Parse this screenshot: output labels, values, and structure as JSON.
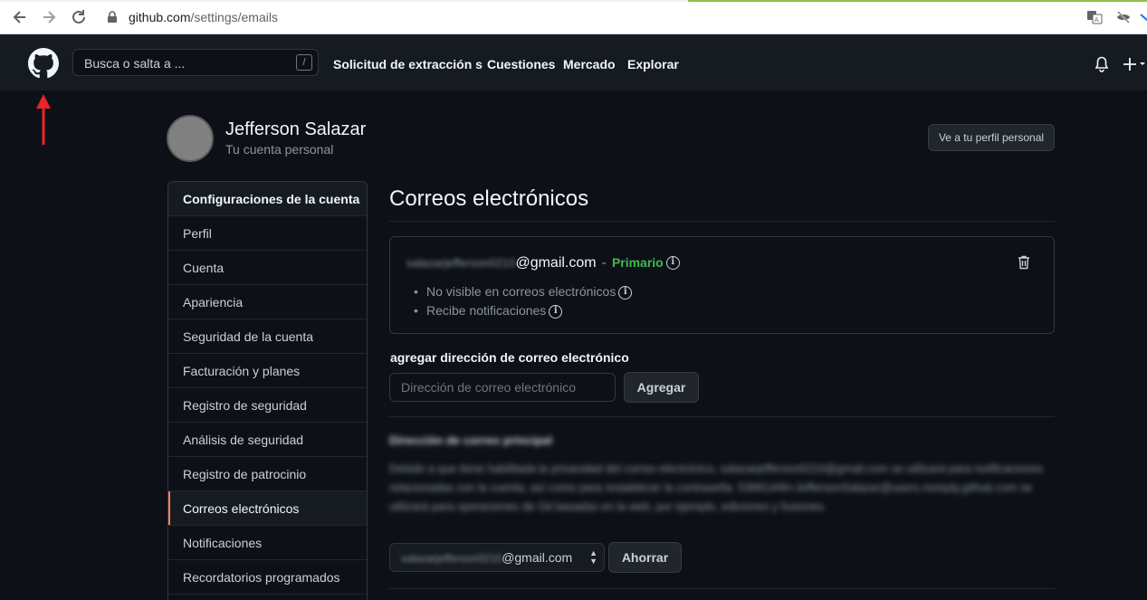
{
  "browser": {
    "url_host": "github.com",
    "url_path": "/settings/emails"
  },
  "header": {
    "search_placeholder": "Busca o salta a ...",
    "search_shortcut": "/",
    "nav": [
      "Solicitud de extracción s",
      "Cuestiones",
      "Mercado",
      "Explorar"
    ]
  },
  "profile": {
    "name": "Jefferson Salazar",
    "subtitle": "Tu cuenta personal",
    "view_profile_button": "Ve a tu perfil personal"
  },
  "sidebar": {
    "items": [
      {
        "label": "Configuraciones de la cuenta"
      },
      {
        "label": "Perfil"
      },
      {
        "label": "Cuenta"
      },
      {
        "label": "Apariencia"
      },
      {
        "label": "Seguridad de la cuenta"
      },
      {
        "label": "Facturación y planes"
      },
      {
        "label": "Registro de seguridad"
      },
      {
        "label": "Análisis de seguridad"
      },
      {
        "label": "Registro de patrocinio"
      },
      {
        "label": "Correos electrónicos"
      },
      {
        "label": "Notificaciones"
      },
      {
        "label": "Recordatorios programados"
      }
    ],
    "active_index": 9
  },
  "main": {
    "title": "Correos electrónicos",
    "email": {
      "redacted_local": "salazarjefferson0210",
      "domain": "@gmail.com",
      "dash": "-",
      "primary_badge": "Primario",
      "bullets": [
        "No visible en correos electrónicos",
        "Recibe notificaciones"
      ]
    },
    "add": {
      "label": "agregar dirección de correo electrónico",
      "placeholder": "Dirección de correo electrónico",
      "button": "Agregar"
    },
    "primary_section": {
      "title": "Dirección de correo principal",
      "text": "Debido a que tiene habilitada la privacidad del correo electrónico, salazarjefferson0210@gmail.com se utilizará para notificaciones relacionadas con la cuenta, así como para restablecer la contraseña. 53961449+JeffersonSalazar@users.noreply.github.com se utilizará para operaciones de Git basadas en la web, por ejemplo, ediciones y fusiones.",
      "select_redacted": "salazarjefferson0210",
      "select_domain": "@gmail.com",
      "save_button": "Ahorrar"
    }
  },
  "colors": {
    "background": "#0d1117",
    "header": "#161b22",
    "primary_green": "#3fb950",
    "active_accent": "#f78166",
    "annotation_arrow": "#e8232a"
  }
}
